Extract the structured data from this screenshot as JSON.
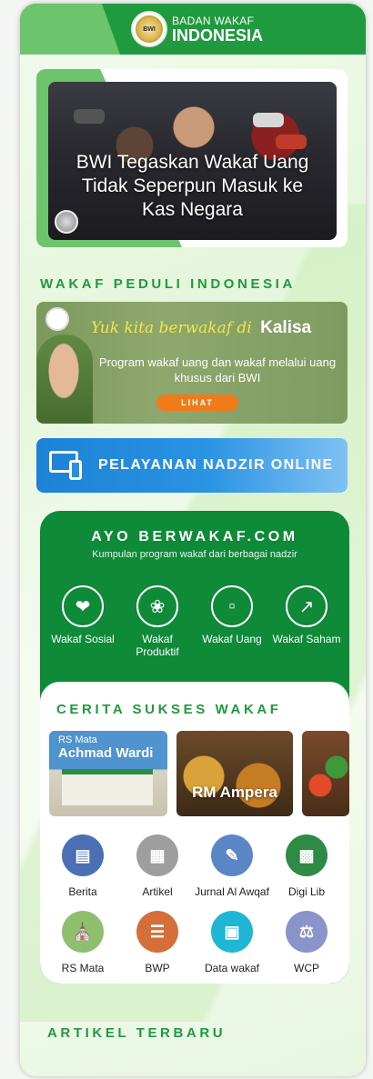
{
  "header": {
    "logo_mark": "BWI",
    "brand_line1": "BADAN WAKAF",
    "brand_line2": "INDONESIA"
  },
  "hero": {
    "headline": "BWI Tegaskan Wakaf Uang Tidak Seperpun Masuk ke Kas Negara"
  },
  "section_peduli": {
    "title": "WAKAF PEDULI INDONESIA"
  },
  "kalisa_banner": {
    "tagline": "Yuk kita berwakaf di",
    "brand": "Kalisa",
    "description": "Program wakaf uang dan wakaf melalui uang khusus dari BWI",
    "button_label": "LIHAT"
  },
  "nadzir": {
    "label": "PELAYANAN NADZIR ONLINE"
  },
  "ayo_berwakaf": {
    "title": "AYO BERWAKAF.COM",
    "subtitle": "Kumpulan program wakaf dari berbagai nadzir",
    "categories": [
      {
        "label": "Wakaf Sosial",
        "icon": "heart-icon"
      },
      {
        "label": "Wakaf Produktif",
        "icon": "wheat-icon"
      },
      {
        "label": "Wakaf Uang",
        "icon": "money-icon"
      },
      {
        "label": "Wakaf Saham",
        "icon": "chart-up-icon"
      }
    ]
  },
  "cerita_sukses": {
    "title": "CERITA SUKSES WAKAF",
    "cards": [
      {
        "line1": "RS Mata",
        "line2": "Achmad Wardi"
      },
      {
        "title": "RM Ampera"
      }
    ]
  },
  "menu": [
    {
      "label": "Berita",
      "color": "#4a6fb3",
      "icon": "newspaper-icon"
    },
    {
      "label": "Artikel",
      "color": "#9e9e9e",
      "icon": "article-icon"
    },
    {
      "label": "Jurnal Al Awqaf",
      "color": "#5a86c8",
      "icon": "journal-pen-icon"
    },
    {
      "label": "Digi Lib",
      "color": "#2f8a45",
      "icon": "library-icon"
    },
    {
      "label": "RS Mata",
      "color": "#8fbf6e",
      "icon": "hospital-icon"
    },
    {
      "label": "BWP",
      "color": "#d46f3a",
      "icon": "bwp-icon"
    },
    {
      "label": "Data wakaf",
      "color": "#1fb6d6",
      "icon": "data-icon"
    },
    {
      "label": "WCP",
      "color": "#8a94c8",
      "icon": "gavel-icon"
    }
  ],
  "section_artikel": {
    "title": "ARTIKEL TERBARU"
  }
}
